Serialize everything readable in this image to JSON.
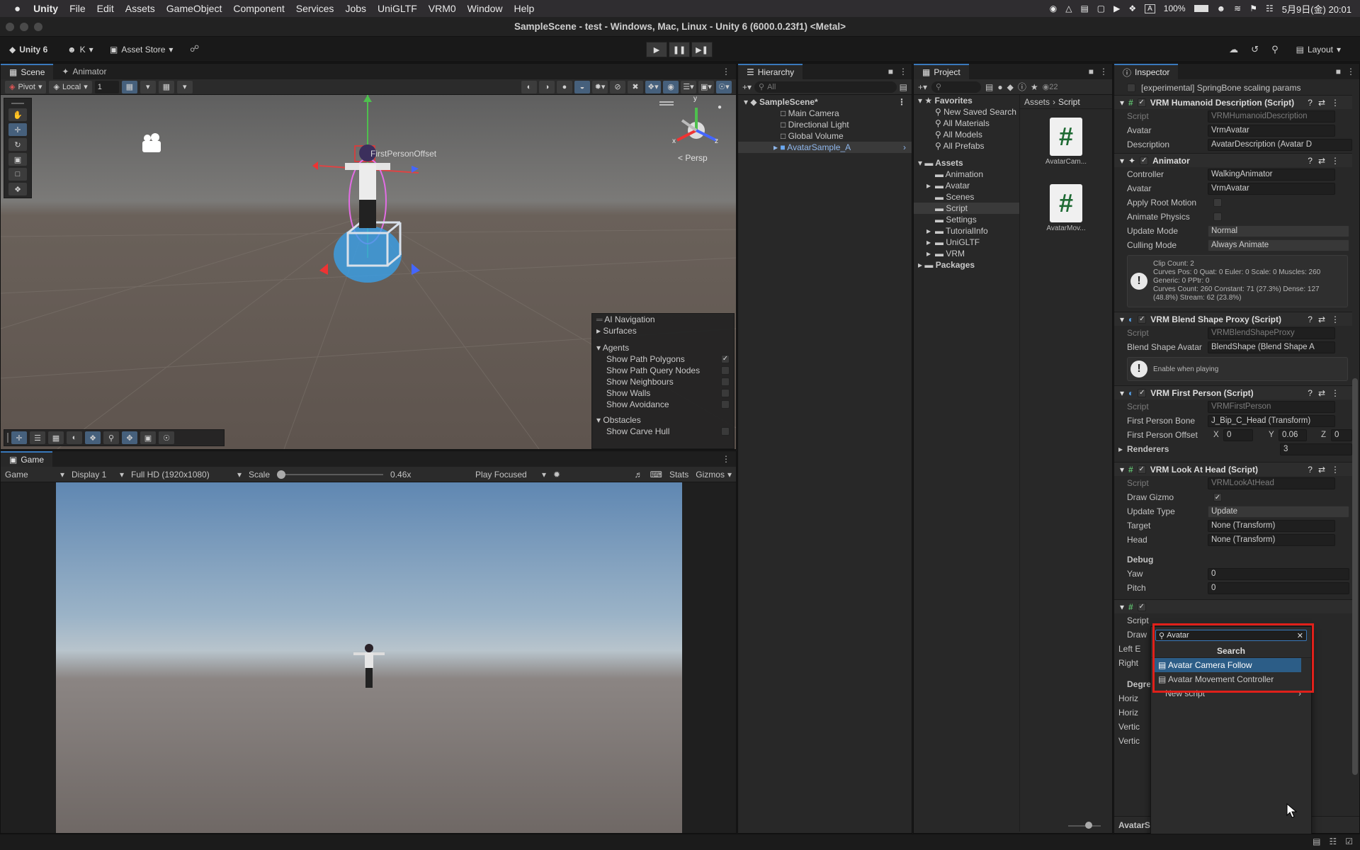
{
  "mac_menu": {
    "app": "Unity",
    "items": [
      "File",
      "Edit",
      "Assets",
      "GameObject",
      "Component",
      "Services",
      "Jobs",
      "UniGLTF",
      "VRM0",
      "Window",
      "Help"
    ],
    "battery": "100%",
    "datetime": "5月9日(金)  20:01"
  },
  "window": {
    "title": "SampleScene - test - Windows, Mac, Linux - Unity 6 (6000.0.23f1) <Metal>"
  },
  "toolbar": {
    "unity_label": "Unity 6",
    "account": "K",
    "asset_store": "Asset Store",
    "layout": "Layout"
  },
  "scene": {
    "tabs": [
      "Scene",
      "Animator"
    ],
    "pivot": "Pivot",
    "local": "Local",
    "grid_step": "1",
    "persp": "< Persp",
    "target_label": "FirstPersonOffset",
    "gizmo_axes": {
      "x": "x",
      "y": "y",
      "z": "z"
    }
  },
  "ai_nav": {
    "title": "AI Navigation",
    "surfaces": "Surfaces",
    "agents": "Agents",
    "agent_items": [
      {
        "label": "Show Path Polygons",
        "checked": true
      },
      {
        "label": "Show Path Query Nodes",
        "checked": false
      },
      {
        "label": "Show Neighbours",
        "checked": false
      },
      {
        "label": "Show Walls",
        "checked": false
      },
      {
        "label": "Show Avoidance",
        "checked": false
      }
    ],
    "obstacles": "Obstacles",
    "carve": "Show Carve Hull"
  },
  "game": {
    "tab": "Game",
    "mode": "Game",
    "display": "Display 1",
    "resolution": "Full HD (1920x1080)",
    "scale_label": "Scale",
    "scale_value": "0.46x",
    "play_focused": "Play Focused",
    "stats": "Stats",
    "gizmos": "Gizmos"
  },
  "hierarchy": {
    "tab": "Hierarchy",
    "search_placeholder": "All",
    "scene": "SampleScene*",
    "items": [
      "Main Camera",
      "Directional Light",
      "Global Volume",
      "AvatarSample_A"
    ]
  },
  "project": {
    "tab": "Project",
    "count": "22",
    "favorites": "Favorites",
    "fav_items": [
      "New Saved Search",
      "All Materials",
      "All Models",
      "All Prefabs"
    ],
    "assets": "Assets",
    "asset_folders": [
      "Animation",
      "Avatar",
      "Scenes",
      "Script",
      "Settings",
      "TutorialInfo",
      "UniGLTF",
      "VRM"
    ],
    "packages": "Packages",
    "breadcrumb": [
      "Assets",
      "Script"
    ],
    "files": [
      "AvatarCam...",
      "AvatarMov..."
    ]
  },
  "inspector": {
    "tab": "Inspector",
    "top_row": "[experimental] SpringBone scaling params",
    "humanoid": {
      "title": "VRM Humanoid Description (Script)",
      "script": "VRMHumanoidDescription",
      "avatar": "VrmAvatar",
      "description": "AvatarDescription (Avatar D"
    },
    "animator": {
      "title": "Animator",
      "controller": "WalkingAnimator",
      "avatar": "VrmAvatar",
      "apply_root_motion": "Apply Root Motion",
      "animate_physics": "Animate Physics",
      "update_mode": "Normal",
      "culling_mode": "Always Animate",
      "info": [
        "Clip Count: 2",
        "Curves Pos: 0 Quat: 0 Euler: 0 Scale: 0 Muscles: 260",
        "Generic: 0 PPtr: 0",
        "Curves Count: 260 Constant: 71 (27.3%) Dense: 127",
        "(48.8%) Stream: 62 (23.8%)"
      ]
    },
    "blend": {
      "title": "VRM Blend Shape Proxy (Script)",
      "script": "VRMBlendShapeProxy",
      "blend_label": "Blend Shape Avatar",
      "blend_value": "BlendShape (Blend Shape A",
      "help": "Enable when playing"
    },
    "first": {
      "title": "VRM First Person (Script)",
      "script": "VRMFirstPerson",
      "bone_label": "First Person Bone",
      "bone": "J_Bip_C_Head (Transform)",
      "offset_label": "First Person Offset",
      "x": "0",
      "y": "0.06",
      "z": "0",
      "renderers": "Renderers",
      "renderers_count": "3"
    },
    "look": {
      "title": "VRM Look At Head (Script)",
      "script": "VRMLookAtHead",
      "draw_gizmo": "Draw Gizmo",
      "update_type": "Update",
      "target": "None (Transform)",
      "head": "None (Transform)",
      "debug": "Debug",
      "yaw": "0",
      "pitch": "0"
    },
    "labels": {
      "script": "Script",
      "avatar": "Avatar",
      "description": "Description",
      "controller": "Controller",
      "update_mode": "Update Mode",
      "culling_mode": "Culling Mode",
      "update_type": "Update Type",
      "target": "Target",
      "head": "Head",
      "yaw": "Yaw",
      "pitch": "Pitch",
      "x": "X",
      "y": "Y",
      "z": "Z"
    },
    "bottom_partial": [
      "Script",
      "Draw",
      "Left E",
      "Right",
      "Degre",
      "Horiz",
      "Horiz",
      "Vertic",
      "Vertic"
    ],
    "footer": "AvatarS"
  },
  "popup": {
    "search_value": "Avatar",
    "header": "Search",
    "results": [
      "Avatar Camera Follow",
      "Avatar Movement Controller"
    ],
    "new_script": "New script"
  },
  "colors": {
    "accent": "#3a79bb",
    "selection": "#2c5d87",
    "highlight_box": "#e0201a"
  }
}
